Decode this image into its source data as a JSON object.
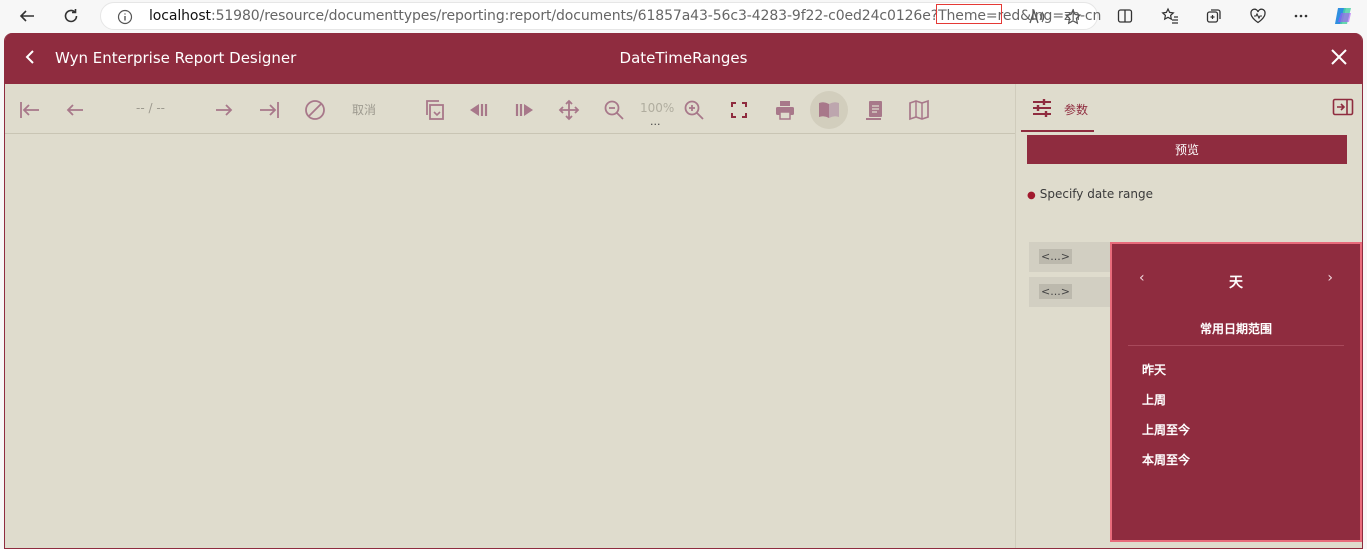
{
  "browser": {
    "url_host": "localhost",
    "url_rest": ":51980/resource/documenttypes/reporting:report/documents/61857a43-56c3-4283-9f22-c0ed24c0126e?Theme=red&lng=zh-cn"
  },
  "header": {
    "app_title": "Wyn Enterprise Report Designer",
    "doc_title": "DateTimeRanges"
  },
  "toolbar": {
    "page_indicator": "-- / --",
    "cancel_label": "取消",
    "zoom_label": "100%"
  },
  "panel": {
    "tab_label": "参数",
    "preview_label": "预览",
    "param_label": "Specify date range",
    "from_value": "<...>",
    "to_value": "<...>"
  },
  "popup": {
    "unit_label": "天",
    "section_title": "常用日期范围",
    "options": [
      "昨天",
      "上周",
      "上周至今",
      "本周至今"
    ]
  },
  "colors": {
    "accent": "#8f2c3f",
    "background": "#dfdccd",
    "highlight": "#e53935"
  }
}
